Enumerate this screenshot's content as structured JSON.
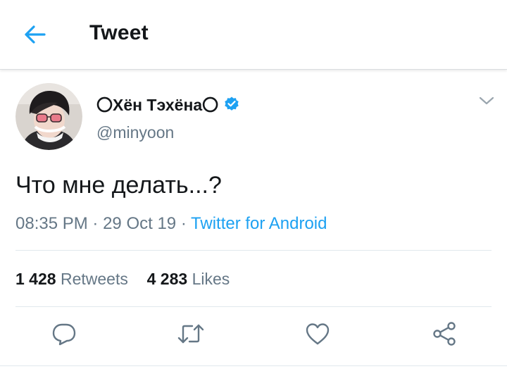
{
  "header": {
    "title": "Tweet",
    "back_icon": "arrow-left-icon"
  },
  "tweet": {
    "display_name": "〇Хён Тэхёна〇",
    "handle": "@minyoon",
    "verified": true,
    "text": "Что мне делать...?",
    "time": "08:35 PM",
    "date": "29 Oct 19",
    "separator": "·",
    "source": "Twitter for Android",
    "stats": {
      "retweets_count": "1 428",
      "retweets_label": "Retweets",
      "likes_count": "4 283",
      "likes_label": "Likes"
    }
  },
  "actions": [
    "reply-icon",
    "retweet-icon",
    "like-icon",
    "share-icon"
  ],
  "colors": {
    "accent": "#1da1f2",
    "text": "#14171a",
    "secondary_text": "#657786",
    "divider": "#e1e8ed"
  }
}
